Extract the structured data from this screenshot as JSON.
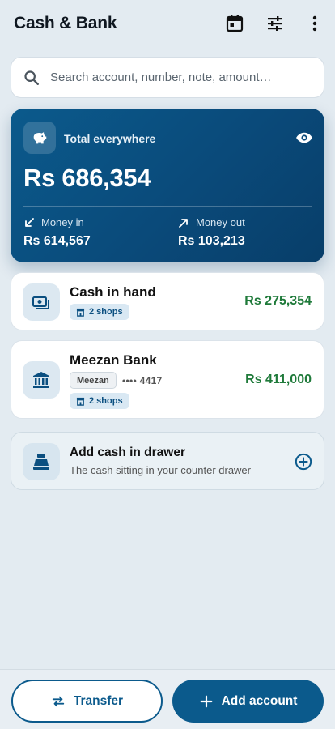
{
  "header": {
    "title": "Cash & Bank",
    "icons": [
      "calendar-icon",
      "filter-sliders-icon",
      "more-vert-icon"
    ]
  },
  "search": {
    "placeholder": "Search account, number, note, amount…"
  },
  "total": {
    "label": "Total everywhere",
    "amount": "Rs 686,354",
    "money_in_label": "Money in",
    "money_in_value": "Rs 614,567",
    "money_out_label": "Money out",
    "money_out_value": "Rs 103,213"
  },
  "accounts": [
    {
      "name": "Cash in hand",
      "shops": "2 shops",
      "value": "Rs 275,354",
      "icon": "cash-icon"
    },
    {
      "name": "Meezan Bank",
      "bank_chip": "Meezan",
      "account_no": "•••• 4417",
      "shops": "2 shops",
      "value": "Rs 411,000",
      "icon": "bank-icon"
    }
  ],
  "add_drawer": {
    "title": "Add cash in drawer",
    "subtitle": "The cash sitting in your counter drawer",
    "icon": "cash-register-icon"
  },
  "bottom": {
    "transfer_label": "Transfer",
    "add_label": "Add account"
  },
  "colors": {
    "primary": "#0b5a8c",
    "positive": "#1f7a3a",
    "background": "#e3ebf1"
  }
}
